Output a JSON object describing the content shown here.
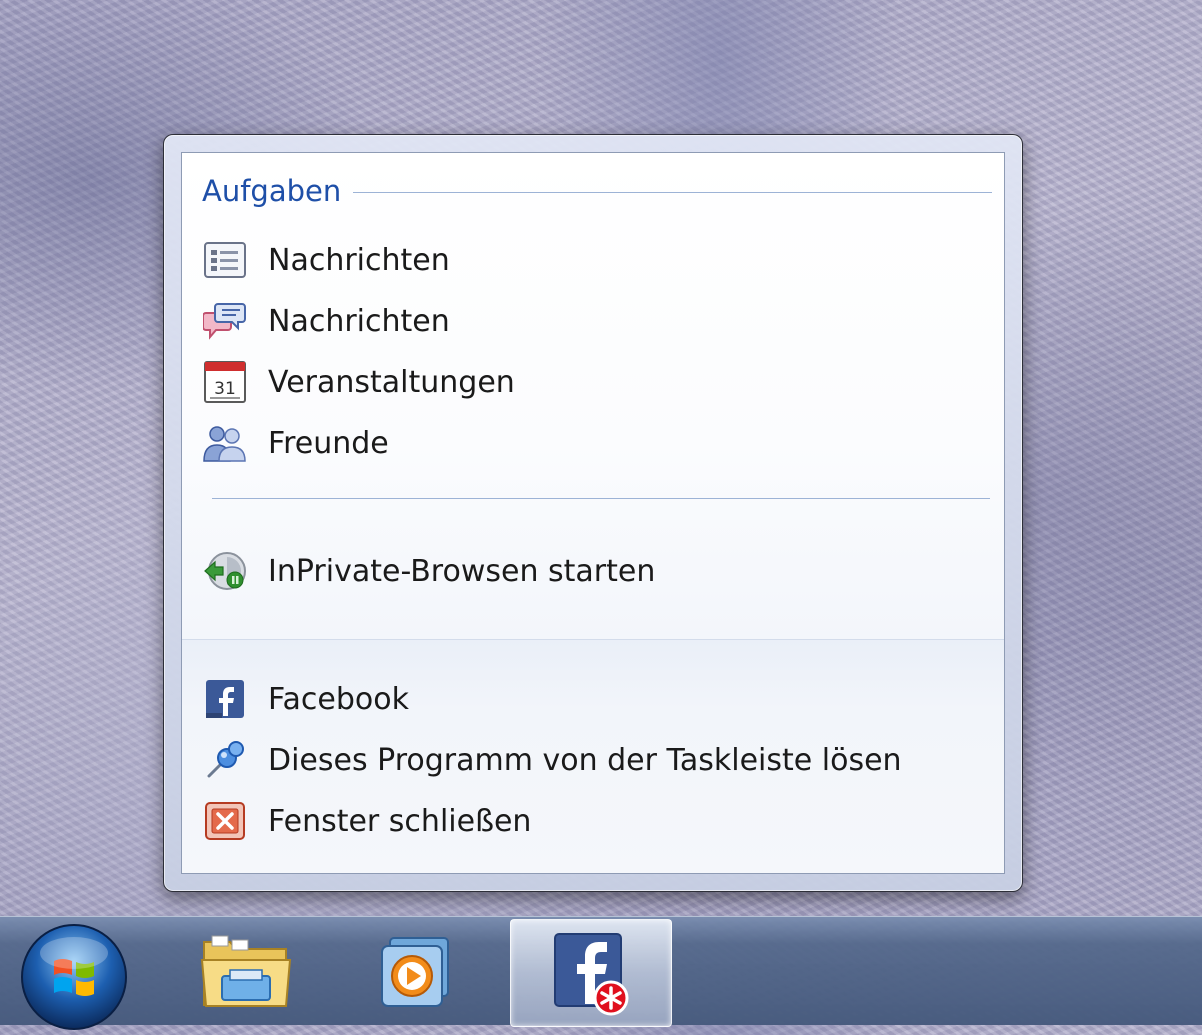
{
  "jumplist": {
    "tasks_header": "Aufgaben",
    "tasks": [
      {
        "label": "Nachrichten",
        "icon": "news-feed-icon"
      },
      {
        "label": "Nachrichten",
        "icon": "messages-icon"
      },
      {
        "label": "Veranstaltungen",
        "icon": "calendar-icon",
        "calendar_day": "31"
      },
      {
        "label": "Freunde",
        "icon": "friends-icon"
      }
    ],
    "inprivate": {
      "label": "InPrivate-Browsen starten",
      "icon": "inprivate-icon"
    },
    "bottom": [
      {
        "label": "Facebook",
        "icon": "facebook-icon"
      },
      {
        "label": "Dieses Programm von der Taskleiste lösen",
        "icon": "unpin-icon"
      },
      {
        "label": "Fenster schließen",
        "icon": "close-window-icon"
      }
    ]
  },
  "taskbar": {
    "buttons": [
      {
        "name": "start-button",
        "icon": "windows-logo-icon"
      },
      {
        "name": "explorer",
        "icon": "folder-icon"
      },
      {
        "name": "media-player",
        "icon": "media-player-icon"
      },
      {
        "name": "facebook",
        "icon": "facebook-icon",
        "active": true
      }
    ]
  },
  "colors": {
    "header_blue": "#1e4fa8",
    "separator": "#9db3d6",
    "facebook_blue": "#3b5998",
    "close_red": "#d9452b"
  }
}
